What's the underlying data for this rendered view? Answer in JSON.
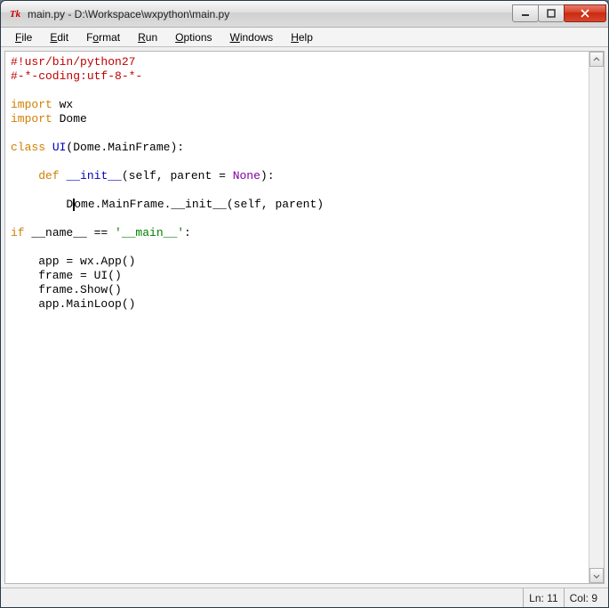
{
  "window": {
    "title": "main.py - D:\\Workspace\\wxpython\\main.py"
  },
  "menubar": {
    "items": [
      {
        "label": "File",
        "ul": "F"
      },
      {
        "label": "Edit",
        "ul": "E"
      },
      {
        "label": "Format",
        "ul": "o"
      },
      {
        "label": "Run",
        "ul": "R"
      },
      {
        "label": "Options",
        "ul": "O"
      },
      {
        "label": "Windows",
        "ul": "W"
      },
      {
        "label": "Help",
        "ul": "H"
      }
    ]
  },
  "code": {
    "tokens": [
      [
        {
          "t": "#!usr/bin/python27",
          "c": "tok-comment"
        }
      ],
      [
        {
          "t": "#-*-coding:utf-8-*-",
          "c": "tok-comment"
        }
      ],
      [],
      [
        {
          "t": "import",
          "c": "tok-kw"
        },
        {
          "t": " wx",
          "c": ""
        }
      ],
      [
        {
          "t": "import",
          "c": "tok-kw"
        },
        {
          "t": " Dome",
          "c": ""
        }
      ],
      [],
      [
        {
          "t": "class",
          "c": "tok-kw"
        },
        {
          "t": " UI",
          "c": "tok-def"
        },
        {
          "t": "(Dome.MainFrame):",
          "c": ""
        }
      ],
      [],
      [
        {
          "t": "    ",
          "c": ""
        },
        {
          "t": "def",
          "c": "tok-kw"
        },
        {
          "t": " ",
          "c": ""
        },
        {
          "t": "__init__",
          "c": "tok-def"
        },
        {
          "t": "(self, parent = ",
          "c": ""
        },
        {
          "t": "None",
          "c": "tok-none"
        },
        {
          "t": "):",
          "c": ""
        }
      ],
      [],
      [
        {
          "t": "        D",
          "c": "",
          "caret": true
        },
        {
          "t": "ome.MainFrame.__init__(self, parent)",
          "c": ""
        }
      ],
      [],
      [
        {
          "t": "if",
          "c": "tok-kw"
        },
        {
          "t": " __name__ == ",
          "c": ""
        },
        {
          "t": "'__main__'",
          "c": "tok-str"
        },
        {
          "t": ":",
          "c": ""
        }
      ],
      [],
      [
        {
          "t": "    app = wx.App()",
          "c": ""
        }
      ],
      [
        {
          "t": "    frame = UI()",
          "c": ""
        }
      ],
      [
        {
          "t": "    frame.Show()",
          "c": ""
        }
      ],
      [
        {
          "t": "    app.MainLoop()",
          "c": ""
        }
      ]
    ]
  },
  "status": {
    "ln_label": "Ln: 11",
    "col_label": "Col: 9"
  },
  "icons": {
    "app": "Tk",
    "min": "min",
    "max": "max",
    "close": "close"
  }
}
